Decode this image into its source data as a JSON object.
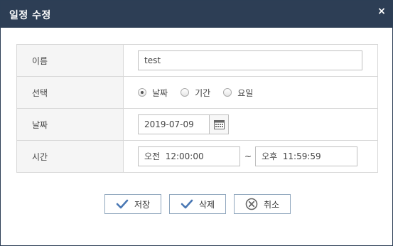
{
  "dialog": {
    "title": "일정 수정",
    "close_glyph": "×"
  },
  "form": {
    "name": {
      "label": "이름",
      "value": "test"
    },
    "select": {
      "label": "선택",
      "options": [
        "날짜",
        "기간",
        "요일"
      ],
      "selected": "날짜"
    },
    "date": {
      "label": "날짜",
      "value": "2019-07-09"
    },
    "time": {
      "label": "시간",
      "start": "오전  12:00:00",
      "separator": "~",
      "end": "오후  11:59:59"
    }
  },
  "buttons": {
    "save": "저장",
    "delete": "삭제",
    "cancel": "취소"
  },
  "colors": {
    "titlebar": "#2d3e55",
    "button_icon": "#4a78b4",
    "cancel_icon": "#666666"
  },
  "icons": {
    "close": "close-icon",
    "calendar": "calendar-icon",
    "save": "check-icon",
    "delete": "check-icon",
    "cancel": "circle-x-icon"
  }
}
